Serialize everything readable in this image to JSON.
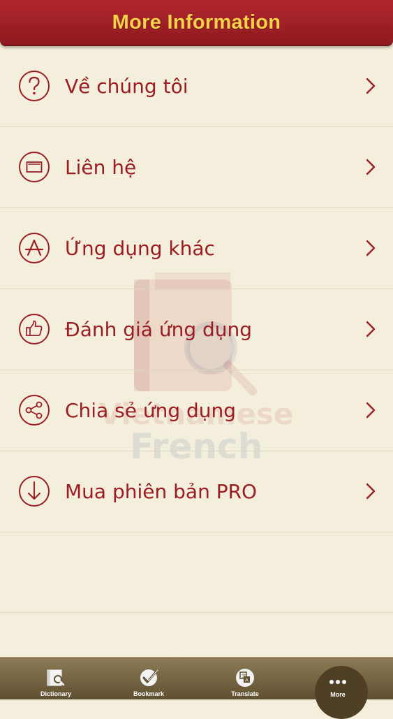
{
  "header": {
    "title": "More Information"
  },
  "menu": {
    "items": [
      {
        "label": "Về chúng tôi",
        "icon": "question-icon"
      },
      {
        "label": "Liên hệ",
        "icon": "envelope-icon"
      },
      {
        "label": "Ứng dụng khác",
        "icon": "app-store-icon"
      },
      {
        "label": "Đánh giá ứng dụng",
        "icon": "thumbs-up-icon"
      },
      {
        "label": "Chia sẻ ứng dụng",
        "icon": "share-icon"
      },
      {
        "label": "Mua phiên bản PRO",
        "icon": "download-icon"
      }
    ]
  },
  "watermark": {
    "line1": "Vietnamese",
    "line2": "French"
  },
  "tabs": [
    {
      "label": "Dictionary",
      "icon": "dictionary-icon"
    },
    {
      "label": "Bookmark",
      "icon": "bookmark-check-icon"
    },
    {
      "label": "Translate",
      "icon": "translate-icon"
    },
    {
      "label": "More",
      "icon": "more-dots-icon"
    }
  ],
  "colors": {
    "header_bg": "#a31f26",
    "header_text": "#f6d24a",
    "menu_text": "#9a1d22",
    "background": "#f4efdc",
    "tabbar_bg": "#7a6a46"
  }
}
